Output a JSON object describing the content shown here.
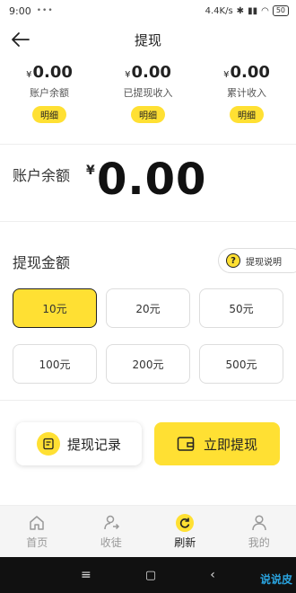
{
  "status": {
    "time": "9:00",
    "network": "4.4K/s",
    "battery": "50"
  },
  "header": {
    "title": "提现"
  },
  "stats": [
    {
      "currency": "¥",
      "value": "0.00",
      "label": "账户余额",
      "detail": "明细"
    },
    {
      "currency": "¥",
      "value": "0.00",
      "label": "已提现收入",
      "detail": "明细"
    },
    {
      "currency": "¥",
      "value": "0.00",
      "label": "累计收入",
      "detail": "明细"
    }
  ],
  "balance": {
    "label": "账户余额",
    "currency": "¥",
    "value": "0.00"
  },
  "amount": {
    "title": "提现金额",
    "explain": "提现说明",
    "options": [
      "10元",
      "20元",
      "50元",
      "100元",
      "200元",
      "500元"
    ],
    "selected": "10元"
  },
  "actions": {
    "record": "提现记录",
    "withdraw": "立即提现"
  },
  "nav": [
    {
      "label": "首页",
      "icon": "home-icon",
      "active": false
    },
    {
      "label": "收徒",
      "icon": "share-user-icon",
      "active": false
    },
    {
      "label": "刷新",
      "icon": "refresh-icon",
      "active": true
    },
    {
      "label": "我的",
      "icon": "profile-icon",
      "active": false
    }
  ],
  "watermark": "说说皮",
  "colors": {
    "accent": "#FFE033",
    "text": "#222222",
    "muted": "#999999"
  }
}
